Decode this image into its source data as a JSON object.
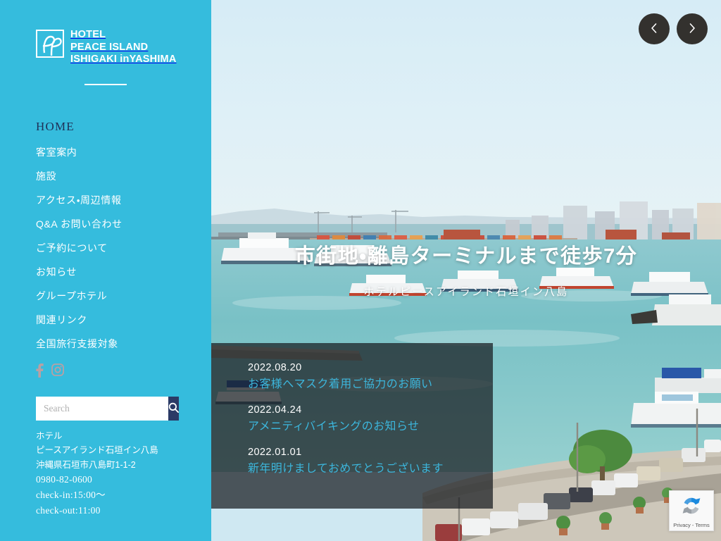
{
  "sidebar": {
    "logo": {
      "line1": "HOTEL",
      "line2": "PEACE ISLAND",
      "line3": "ISHIGAKI inYASHIMA",
      "mark": "ep-monogram-icon"
    },
    "nav": [
      {
        "label": "HOME",
        "active": true
      },
      {
        "label": "客室案内",
        "active": false
      },
      {
        "label": "施設",
        "active": false
      },
      {
        "label": "アクセス・周辺情報",
        "active": false
      },
      {
        "label": "Q&A お問い合わせ",
        "active": false
      },
      {
        "label": "ご予約について",
        "active": false
      },
      {
        "label": "お知らせ",
        "active": false
      },
      {
        "label": "グループホテル",
        "active": false
      },
      {
        "label": "関連リンク",
        "active": false
      },
      {
        "label": "全国旅行支援対象",
        "active": false
      }
    ],
    "social": [
      {
        "name": "facebook-icon"
      },
      {
        "name": "instagram-icon"
      }
    ],
    "search": {
      "placeholder": "Search",
      "value": "",
      "button_icon": "search-icon"
    },
    "contact": {
      "line1": "ホテル",
      "line2": "ピースアイランド石垣イン八島",
      "line3": "沖縄県石垣市八島町1-1-2",
      "line4": "0980-82-0600",
      "line5": "check-in:15:00〜",
      "line6": "check-out:11:00"
    },
    "colors": {
      "background": "#35bcdd",
      "nav_text": "#ffffff",
      "nav_active": "#1f3057",
      "search_button": "#2b3a66"
    }
  },
  "hero": {
    "title": "市街地・離島ターミナルまで徒歩7分",
    "subtitle": "ホテルピースアイランド石垣イン八島",
    "prev_label": "‹",
    "next_label": "›",
    "prev_icon": "chevron-left-icon",
    "next_icon": "chevron-right-icon"
  },
  "news": {
    "items": [
      {
        "date": "2022.08.20",
        "title": "お客様へマスク着用ご協力のお願い"
      },
      {
        "date": "2022.04.24",
        "title": "アメニティバイキングのお知らせ"
      },
      {
        "date": "2022.01.01",
        "title": "新年明けましておめでとうございます"
      }
    ],
    "colors": {
      "date": "#ffffff",
      "title": "#3cb6dc"
    }
  },
  "recaptcha": {
    "label": "Privacy - Terms",
    "icon": "recaptcha-icon"
  }
}
